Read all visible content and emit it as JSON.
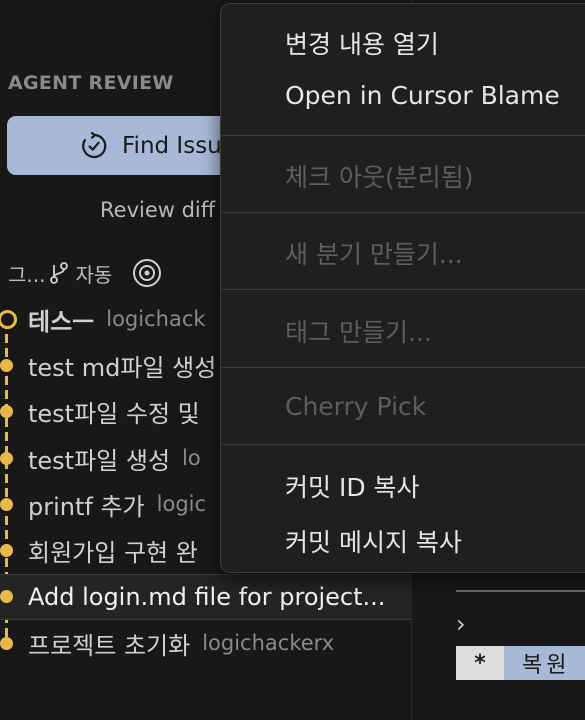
{
  "sidebar": {
    "section_title": "AGENT REVIEW",
    "find_button_label": "Find Issu",
    "review_text": "Review diff",
    "toolbar": {
      "branch_prefix": "그...",
      "auto_label": "자동"
    },
    "commits": [
      {
        "message": "테스ㅡ",
        "author": "logichack"
      },
      {
        "message": "test md파일 생성",
        "author": ""
      },
      {
        "message": "test파일 수정 및",
        "author": ""
      },
      {
        "message": "test파일 생성",
        "author": "lo"
      },
      {
        "message": "printf 추가",
        "author": "logic"
      },
      {
        "message": "회원가입 구현 완",
        "author": ""
      },
      {
        "message": "Add login.md file for project...",
        "author": ""
      },
      {
        "message": "프로젝트 초기화",
        "author": "logichackerx"
      }
    ]
  },
  "context_menu": {
    "items": [
      {
        "label": "변경 내용 열기",
        "enabled": true
      },
      {
        "label": "Open in Cursor Blame",
        "enabled": true
      },
      {
        "label": "체크 아웃(분리됨)",
        "enabled": false
      },
      {
        "label": "새 분기 만들기...",
        "enabled": false
      },
      {
        "label": "태그 만들기...",
        "enabled": false
      },
      {
        "label": "Cherry Pick",
        "enabled": false
      },
      {
        "label": "커밋 ID 복사",
        "enabled": true
      },
      {
        "label": "커밋 메시지 복사",
        "enabled": true
      }
    ]
  },
  "right_panel": {
    "chevron": "›",
    "restore_star": "*",
    "restore_label": "복원"
  },
  "colors": {
    "background": "#181818",
    "accent_button": "#a7b9d7",
    "graph": "#e9b84a",
    "menu_bg": "#1f1f1f"
  },
  "icons": [
    "refresh-check-icon",
    "git-branch-icon",
    "target-icon",
    "chevron-right-icon"
  ]
}
